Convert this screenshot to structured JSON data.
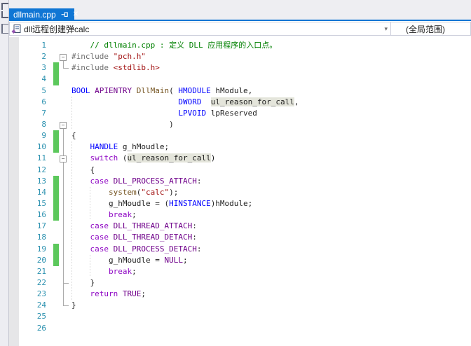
{
  "colors": {
    "accent": "#1076D4",
    "line_number": "#2B91AF",
    "changed_line_bar": "#5CC85C",
    "highlight_bg": "#E4E5DB",
    "plain": "#1E1E1E",
    "comment": "#008000",
    "preprocessor": "#6E6E6E",
    "string": "#A31515",
    "keyword_type": "#0000FF",
    "keyword_control": "#8F08C4",
    "macro": "#6F008A",
    "function": "#74531F"
  },
  "icons": {
    "close": "✕",
    "chevron_down": "▾",
    "collapse_minus": "−",
    "pin": "pin-icon",
    "file": "cpp-file-icon"
  },
  "tab_bar": {
    "active_tab": {
      "title": "dllmain.cpp"
    }
  },
  "nav_bar": {
    "symbol": "dll远程创建弹calc",
    "scope": "(全局范围)"
  },
  "editor": {
    "line_count": 26,
    "changed_lines": [
      3,
      4,
      9,
      10,
      13,
      14,
      15,
      16,
      19,
      20
    ],
    "collapse_boxes": [
      2,
      8,
      11
    ],
    "outline_rules": [
      {
        "box": 2,
        "end": 3,
        "stubs": [
          3
        ]
      },
      {
        "box": 8,
        "end": 24,
        "stubs": [
          22,
          24
        ]
      }
    ],
    "indent_guides": [
      {
        "col": 0,
        "from": 6,
        "to": 8
      },
      {
        "col": 0,
        "from": 10,
        "to": 23
      },
      {
        "col": 4,
        "from": 14,
        "to": 16
      },
      {
        "col": 4,
        "from": 20,
        "to": 21
      }
    ],
    "lines": [
      {
        "n": 1,
        "t": [
          [
            "    ",
            "pln"
          ],
          [
            "// dllmain.cpp : 定义 DLL 应用程序的入口点。",
            "com"
          ]
        ]
      },
      {
        "n": 2,
        "t": [
          [
            "#include",
            "pp"
          ],
          [
            " ",
            "pln"
          ],
          [
            "\"pch.h\"",
            "str"
          ]
        ]
      },
      {
        "n": 3,
        "t": [
          [
            "#include",
            "pp"
          ],
          [
            " ",
            "pln"
          ],
          [
            "<stdlib.h>",
            "str"
          ]
        ]
      },
      {
        "n": 4,
        "t": []
      },
      {
        "n": 5,
        "t": [
          [
            "BOOL",
            "kw"
          ],
          [
            " ",
            "pln"
          ],
          [
            "APIENTRY",
            "mac"
          ],
          [
            " ",
            "pln"
          ],
          [
            "DllMain",
            "fn"
          ],
          [
            "( ",
            "pln"
          ],
          [
            "HMODULE",
            "kw"
          ],
          [
            " hModule,",
            "pln"
          ]
        ]
      },
      {
        "n": 6,
        "t": [
          [
            "                       ",
            "pln"
          ],
          [
            "DWORD",
            "kw"
          ],
          [
            "  ",
            "pln"
          ],
          [
            "ul_reason_for_call",
            "hl"
          ],
          [
            ",",
            "pln"
          ]
        ]
      },
      {
        "n": 7,
        "t": [
          [
            "                       ",
            "pln"
          ],
          [
            "LPVOID",
            "kw"
          ],
          [
            " lpReserved",
            "pln"
          ]
        ]
      },
      {
        "n": 8,
        "t": [
          [
            "                     )",
            "pln"
          ]
        ]
      },
      {
        "n": 9,
        "t": [
          [
            "{",
            "pln"
          ]
        ]
      },
      {
        "n": 10,
        "t": [
          [
            "    ",
            "pln"
          ],
          [
            "HANDLE",
            "kw"
          ],
          [
            " g_hMoudle;",
            "pln"
          ]
        ]
      },
      {
        "n": 11,
        "t": [
          [
            "    ",
            "pln"
          ],
          [
            "switch",
            "ctl"
          ],
          [
            " (",
            "pln"
          ],
          [
            "ul_reason_for_call",
            "hl"
          ],
          [
            ")",
            "pln"
          ]
        ]
      },
      {
        "n": 12,
        "t": [
          [
            "    {",
            "pln"
          ]
        ]
      },
      {
        "n": 13,
        "t": [
          [
            "    ",
            "pln"
          ],
          [
            "case",
            "ctl"
          ],
          [
            " ",
            "pln"
          ],
          [
            "DLL_PROCESS_ATTACH",
            "mac"
          ],
          [
            ":",
            "pln"
          ]
        ]
      },
      {
        "n": 14,
        "t": [
          [
            "        ",
            "pln"
          ],
          [
            "system",
            "fn"
          ],
          [
            "(",
            "pln"
          ],
          [
            "\"calc\"",
            "str"
          ],
          [
            ");",
            "pln"
          ]
        ]
      },
      {
        "n": 15,
        "t": [
          [
            "        g_hMoudle = (",
            "pln"
          ],
          [
            "HINSTANCE",
            "kw"
          ],
          [
            ")hModule;",
            "pln"
          ]
        ]
      },
      {
        "n": 16,
        "t": [
          [
            "        ",
            "pln"
          ],
          [
            "break",
            "ctl"
          ],
          [
            ";",
            "pln"
          ]
        ]
      },
      {
        "n": 17,
        "t": [
          [
            "    ",
            "pln"
          ],
          [
            "case",
            "ctl"
          ],
          [
            " ",
            "pln"
          ],
          [
            "DLL_THREAD_ATTACH",
            "mac"
          ],
          [
            ":",
            "pln"
          ]
        ]
      },
      {
        "n": 18,
        "t": [
          [
            "    ",
            "pln"
          ],
          [
            "case",
            "ctl"
          ],
          [
            " ",
            "pln"
          ],
          [
            "DLL_THREAD_DETACH",
            "mac"
          ],
          [
            ":",
            "pln"
          ]
        ]
      },
      {
        "n": 19,
        "t": [
          [
            "    ",
            "pln"
          ],
          [
            "case",
            "ctl"
          ],
          [
            " ",
            "pln"
          ],
          [
            "DLL_PROCESS_DETACH",
            "mac"
          ],
          [
            ":",
            "pln"
          ]
        ]
      },
      {
        "n": 20,
        "t": [
          [
            "        g_hMoudle = ",
            "pln"
          ],
          [
            "NULL",
            "mac"
          ],
          [
            ";",
            "pln"
          ]
        ]
      },
      {
        "n": 21,
        "t": [
          [
            "        ",
            "pln"
          ],
          [
            "break",
            "ctl"
          ],
          [
            ";",
            "pln"
          ]
        ]
      },
      {
        "n": 22,
        "t": [
          [
            "    }",
            "pln"
          ]
        ]
      },
      {
        "n": 23,
        "t": [
          [
            "    ",
            "pln"
          ],
          [
            "return",
            "ctl"
          ],
          [
            " ",
            "pln"
          ],
          [
            "TRUE",
            "mac"
          ],
          [
            ";",
            "pln"
          ]
        ]
      },
      {
        "n": 24,
        "t": [
          [
            "}",
            "pln"
          ]
        ]
      },
      {
        "n": 25,
        "t": []
      },
      {
        "n": 26,
        "t": []
      }
    ]
  }
}
